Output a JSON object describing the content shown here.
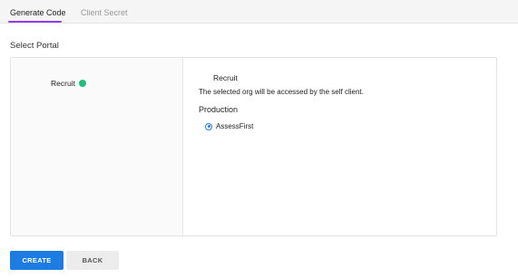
{
  "tabs": {
    "generate_code": "Generate Code",
    "client_secret": "Client Secret"
  },
  "section_title": "Select Portal",
  "portals": [
    {
      "label": "Recruit",
      "status_color": "#1fbe7a"
    }
  ],
  "details": {
    "title": "Recruit",
    "description": "The selected org will be accessed by the self client.",
    "environment_label": "Production",
    "org_option": "AssessFirst"
  },
  "buttons": {
    "create": "CREATE",
    "back": "BACK"
  },
  "colors": {
    "accent_tab": "#8a3ff0",
    "primary_button": "#1d7ce2",
    "status_active": "#1fbe7a"
  }
}
